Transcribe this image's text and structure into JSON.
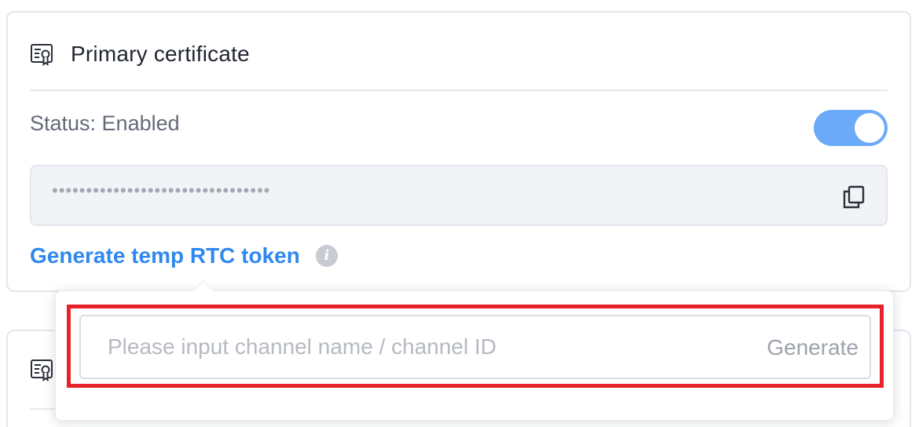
{
  "primary_card": {
    "title": "Primary certificate",
    "status_text": "Status: Enabled",
    "toggle_on": true,
    "secret_masked": "••••••••••••••••••••••••••••••••",
    "token_link": "Generate temp RTC token",
    "info_glyph": "i",
    "icons": {
      "header": "certificate-icon",
      "copy": "copy-icon",
      "info": "info-icon"
    }
  },
  "secondary_card": {
    "icons": {
      "header": "certificate-icon"
    }
  },
  "token_popover": {
    "input_placeholder": "Please input channel name / channel ID",
    "input_value": "",
    "generate_label": "Generate"
  },
  "colors": {
    "accent": "#2f88f0",
    "toggle_on": "#6aaaf8",
    "highlight": "#e8222b"
  }
}
